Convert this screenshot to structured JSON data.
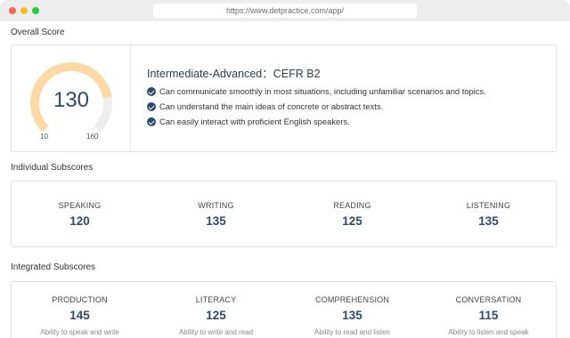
{
  "browser": {
    "url": "https://www.detpractice.com/app/"
  },
  "overall": {
    "section_title": "Overall Score",
    "score": "130",
    "score_value": 130,
    "min": "10",
    "max": "160",
    "min_value": 10,
    "max_value": 160,
    "level": "Intermediate-Advanced：CEFR B2",
    "descriptions": [
      "Can communicate smoothly in most situations, including unfamiliar scenarios and topics.",
      "Can understand the main ideas of concrete or abstract texts.",
      "Can easily interact with proficient English speakers."
    ],
    "colors": {
      "arc_fill": "#fdd9a6",
      "arc_track": "#eeeeee",
      "score": "#2f4a6e"
    }
  },
  "individual": {
    "section_title": "Individual Subscores",
    "items": [
      {
        "label": "SPEAKING",
        "value": "120"
      },
      {
        "label": "WRITING",
        "value": "135"
      },
      {
        "label": "READING",
        "value": "125"
      },
      {
        "label": "LISTENING",
        "value": "135"
      }
    ]
  },
  "integrated": {
    "section_title": "Integrated Subscores",
    "items": [
      {
        "label": "PRODUCTION",
        "value": "145",
        "desc": "Ability to speak and write"
      },
      {
        "label": "LITERACY",
        "value": "125",
        "desc": "Ability to write and read"
      },
      {
        "label": "COMPREHENSION",
        "value": "135",
        "desc": "Ability to read and listen"
      },
      {
        "label": "CONVERSATION",
        "value": "115",
        "desc": "Ability to listen and speak"
      }
    ]
  }
}
